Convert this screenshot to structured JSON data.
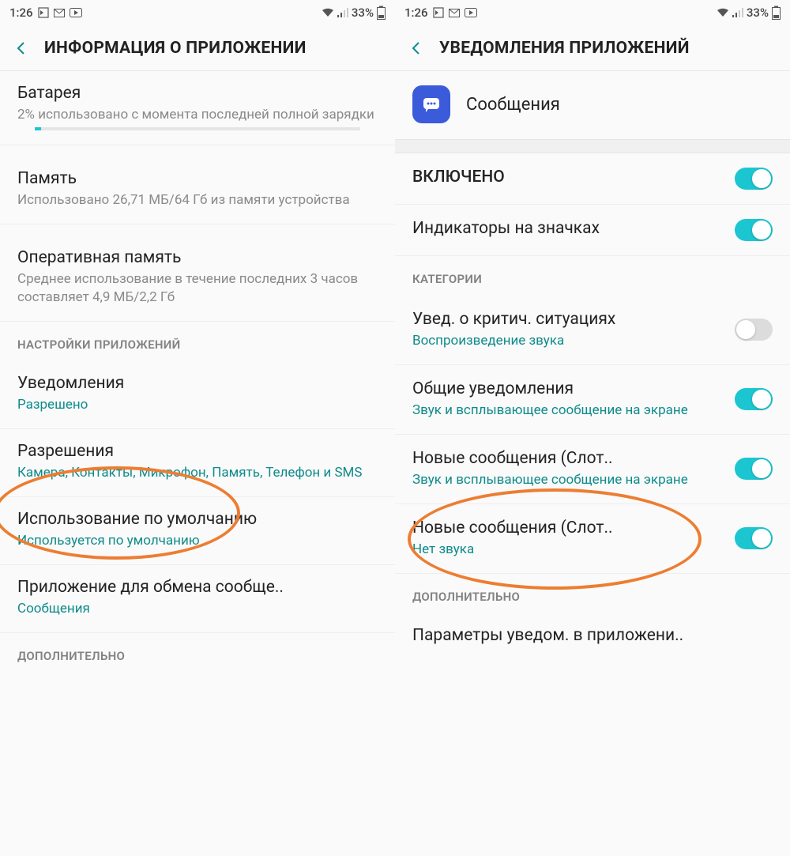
{
  "statusbar": {
    "time": "1:26",
    "battery": "33%"
  },
  "left": {
    "title": "ИНФОРМАЦИЯ О ПРИЛОЖЕНИИ",
    "battery": {
      "title": "Батарея",
      "sub": "2% использовано с момента последней полной зарядки"
    },
    "storage": {
      "title": "Память",
      "sub": "Использовано 26,71 МБ/64 Гб из памяти устройства"
    },
    "ram": {
      "title": "Оперативная память",
      "sub": "Среднее использование в течение последних 3 часов составляет 4,9 МБ/2,2 Гб"
    },
    "sectionApp": "НАСТРОЙКИ ПРИЛОЖЕНИЙ",
    "notifications": {
      "title": "Уведомления",
      "sub": "Разрешено"
    },
    "permissions": {
      "title": "Разрешения",
      "sub": "Камера, Контакты, Микрофон, Память, Телефон и SMS"
    },
    "default": {
      "title": "Использование по умолчанию",
      "sub": "Используется по умолчанию"
    },
    "sms": {
      "title": "Приложение для обмена сообще..",
      "sub": "Сообщения"
    },
    "sectionExtra": "ДОПОЛНИТЕЛЬНО"
  },
  "right": {
    "title": "УВЕДОМЛЕНИЯ ПРИЛОЖЕНИЙ",
    "appName": "Сообщения",
    "enabled": "ВКЛЮЧЕНО",
    "badges": "Индикаторы на значках",
    "sectionCat": "КАТЕГОРИИ",
    "critical": {
      "title": "Увед. о критич. ситуациях",
      "sub": "Воспроизведение звука"
    },
    "general": {
      "title": "Общие уведомления",
      "sub": "Звук и всплывающее сообщение на экране"
    },
    "slot1": {
      "title": "Новые сообщения (Слот..",
      "sub": "Звук и всплывающее сообщение на экране"
    },
    "slot2": {
      "title": "Новые сообщения (Слот..",
      "sub": "Нет звука"
    },
    "sectionExtra": "ДОПОЛНИТЕЛЬНО",
    "params": "Параметры уведом. в приложени.."
  }
}
